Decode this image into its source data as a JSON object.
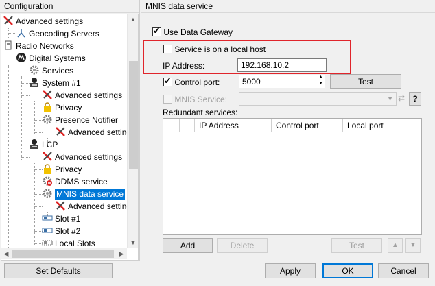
{
  "left_panel": {
    "title": "Configuration",
    "tree": [
      {
        "label": "Advanced settings",
        "icon": "tools-icon"
      },
      {
        "label": "Geocoding Servers",
        "icon": "network-icon"
      },
      {
        "label": "Radio Networks",
        "icon": "radio-icon"
      },
      {
        "label": "Digital Systems",
        "icon": "motorola-icon"
      },
      {
        "label": "Services",
        "icon": "gear-icon"
      },
      {
        "label": "System #1",
        "icon": "system-icon"
      },
      {
        "label": "Advanced settings",
        "icon": "tools-icon"
      },
      {
        "label": "Privacy",
        "icon": "lock-icon"
      },
      {
        "label": "Presence Notifier",
        "icon": "gear-icon"
      },
      {
        "label": "Advanced setting",
        "icon": "tools-icon"
      },
      {
        "label": "LCP",
        "icon": "system-icon"
      },
      {
        "label": "Advanced settings",
        "icon": "tools-icon"
      },
      {
        "label": "Privacy",
        "icon": "lock-icon"
      },
      {
        "label": "DDMS service",
        "icon": "ddms-icon"
      },
      {
        "label": "MNIS data service",
        "icon": "gear-icon"
      },
      {
        "label": "Advanced setting",
        "icon": "tools-icon"
      },
      {
        "label": "Slot #1",
        "icon": "slot-icon"
      },
      {
        "label": "Slot #2",
        "icon": "slot-icon"
      },
      {
        "label": "Local Slots",
        "icon": "slot-icon"
      }
    ]
  },
  "right_panel": {
    "title": "MNIS data service",
    "use_data_gateway": "Use Data Gateway",
    "local_host": "Service is on a local host",
    "ip_label": "IP Address:",
    "ip_value": "192.168.10.2",
    "control_port_label": "Control port:",
    "control_port_value": "5000",
    "test_label": "Test",
    "mnis_service_label": "MNIS Service:",
    "help_label": "?",
    "redundant_label": "Redundant services:",
    "columns": [
      "IP Address",
      "Control port",
      "Local port"
    ],
    "add_label": "Add",
    "delete_label": "Delete",
    "grid_test_label": "Test"
  },
  "bottom": {
    "set_defaults": "Set Defaults",
    "apply": "Apply",
    "ok": "OK",
    "cancel": "Cancel"
  },
  "colors": {
    "selection": "#0078d7",
    "highlight": "#e0252b"
  }
}
